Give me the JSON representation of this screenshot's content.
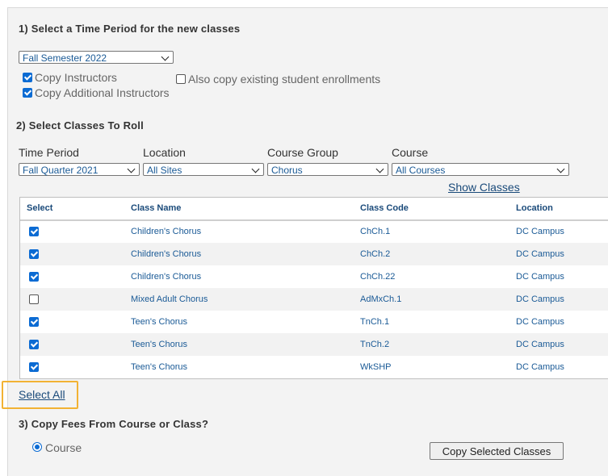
{
  "section1": {
    "heading": "1) Select a Time Period for the new classes",
    "time_period": "Fall Semester 2022",
    "copy_instructors": {
      "label": "Copy Instructors",
      "checked": true
    },
    "copy_additional": {
      "label": "Copy Additional Instructors",
      "checked": true
    },
    "copy_enrollments": {
      "label": "Also copy existing student enrollments",
      "checked": false
    }
  },
  "section2": {
    "heading": "2) Select Classes To Roll",
    "filters": {
      "time_period": {
        "label": "Time Period",
        "value": "Fall Quarter 2021"
      },
      "location": {
        "label": "Location",
        "value": "All Sites"
      },
      "course_group": {
        "label": "Course Group",
        "value": "Chorus"
      },
      "course": {
        "label": "Course",
        "value": "All Courses"
      }
    },
    "show_classes": "Show Classes",
    "table": {
      "headers": [
        "Select",
        "Class Name",
        "Class Code",
        "Location"
      ],
      "rows": [
        {
          "checked": true,
          "class_name": "Children's Chorus",
          "class_code": "ChCh.1",
          "location": "DC Campus"
        },
        {
          "checked": true,
          "class_name": "Children's Chorus",
          "class_code": "ChCh.2",
          "location": "DC Campus"
        },
        {
          "checked": true,
          "class_name": "Children's Chorus",
          "class_code": "ChCh.22",
          "location": "DC Campus"
        },
        {
          "checked": false,
          "class_name": "Mixed Adult Chorus",
          "class_code": "AdMxCh.1",
          "location": "DC Campus"
        },
        {
          "checked": true,
          "class_name": "Teen's Chorus",
          "class_code": "TnCh.1",
          "location": "DC Campus"
        },
        {
          "checked": true,
          "class_name": "Teen's Chorus",
          "class_code": "TnCh.2",
          "location": "DC Campus"
        },
        {
          "checked": true,
          "class_name": "Teen's Chorus",
          "class_code": "WkSHP",
          "location": "DC Campus"
        }
      ]
    },
    "select_all": "Select All"
  },
  "section3": {
    "heading": "3) Copy Fees From Course or Class?",
    "option_course": "Course",
    "copy_button": "Copy Selected Classes"
  },
  "colors": {
    "accent": "#0b6bd3",
    "link": "#1a4a7a",
    "highlight": "#f2b233"
  }
}
